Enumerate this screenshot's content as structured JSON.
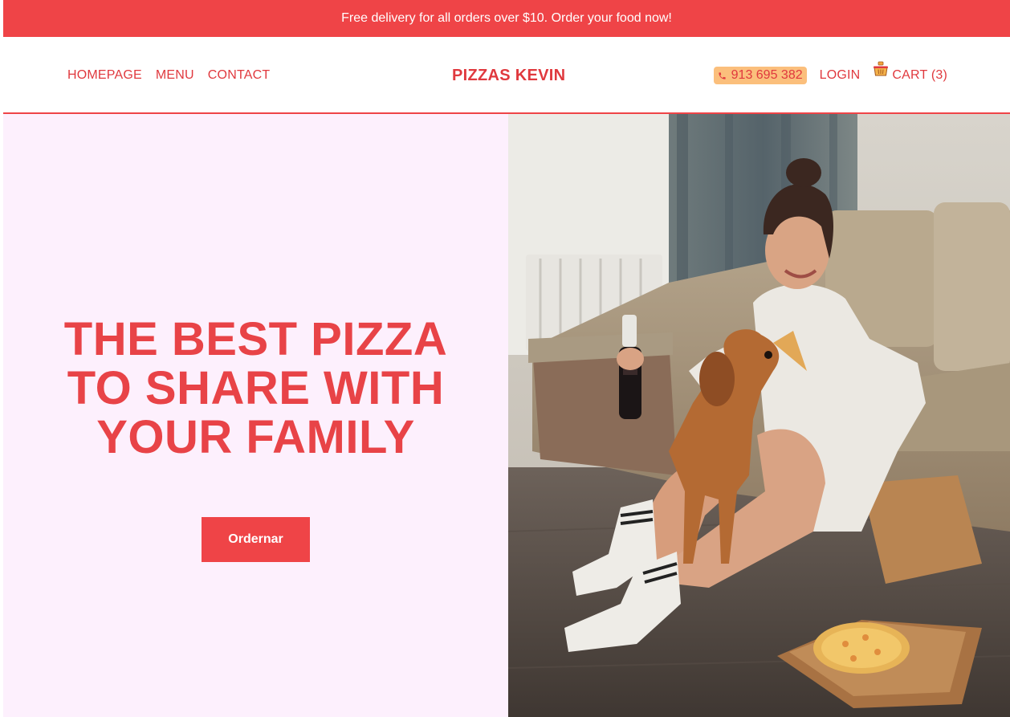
{
  "promo": {
    "text": "Free delivery for all orders over $10. Order your food now!"
  },
  "nav": {
    "items": [
      {
        "label": "HOMEPAGE"
      },
      {
        "label": "MENU"
      },
      {
        "label": "CONTACT"
      }
    ],
    "brand": "PIZZAS KEVIN",
    "phone": "913 695 382",
    "login": "LOGIN",
    "cart": "CART (3)"
  },
  "hero": {
    "title_lines": [
      "THE BEST PIZZA",
      "TO SHARE WITH",
      "YOUR FAMILY"
    ],
    "button_label": "Ordernar"
  },
  "icons": {
    "phone": "phone-icon",
    "cart": "shopping-basket-icon"
  },
  "colors": {
    "accent": "#ef4447",
    "hero_background": "#fdf0fd",
    "phone_badge": "#fbbf7c"
  }
}
